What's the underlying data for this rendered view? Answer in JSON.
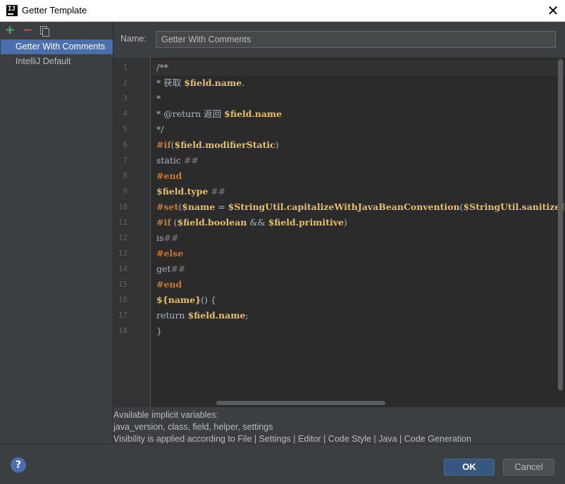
{
  "window": {
    "title": "Getter Template",
    "close_glyph": "✕"
  },
  "toolbar": {
    "add_icon": "plus-icon",
    "remove_icon": "minus-icon",
    "copy_icon": "copy-icon"
  },
  "templates": [
    "Getter With Comments",
    "IntelliJ Default"
  ],
  "selected_template": "Getter With Comments",
  "name": {
    "label": "Name:",
    "value": "Getter With Comments"
  },
  "line_numbers": [
    "1",
    "2",
    "3",
    "4",
    "5",
    "6",
    "7",
    "8",
    "9",
    "10",
    "11",
    "12",
    "13",
    "14",
    "15",
    "16",
    "17",
    "18"
  ],
  "code": {
    "l1": "/**",
    "l2_a": "* 获取 ",
    "l2_v": "$field.name",
    "l2_b": ".",
    "l3": "*",
    "l4_a": "* @return 返回 ",
    "l4_v": "$field.name",
    "l5": "*/",
    "l6_d": "#if",
    "l6_a": "(",
    "l6_v": "$field.modifierStatic",
    "l6_b": ")",
    "l7_a": "static ",
    "l7_c": "##",
    "l8_d": "#end",
    "l9_v": "$field.type",
    "l9_c": " ##",
    "l10_d": "#set",
    "l10_a": "(",
    "l10_v1": "$name",
    "l10_b": " = ",
    "l10_v2": "$StringUtil.capitalizeWithJavaBeanConvention",
    "l10_c": "(",
    "l10_v3": "$StringUtil.sanitizeJava",
    "l11_d": "#if",
    "l11_a": " (",
    "l11_v1": "$field.boolean",
    "l11_b": " && ",
    "l11_v2": "$field.primitive",
    "l11_c": ")",
    "l12_a": "is",
    "l12_c": "##",
    "l13_d": "#else",
    "l14_a": "get",
    "l14_c": "##",
    "l15_d": "#end",
    "l16_v": "${name}",
    "l16_a": "() {",
    "l17_a": "return ",
    "l17_v": "$field.name",
    "l17_b": ";",
    "l18": "}"
  },
  "info": {
    "line1": "Available implicit variables:",
    "line2": "java_version, class, field, helper, settings",
    "line3": "Visibility is applied according to File | Settings | Editor | Code Style | Java | Code Generation"
  },
  "buttons": {
    "help": "?",
    "ok": "OK",
    "cancel": "Cancel"
  }
}
